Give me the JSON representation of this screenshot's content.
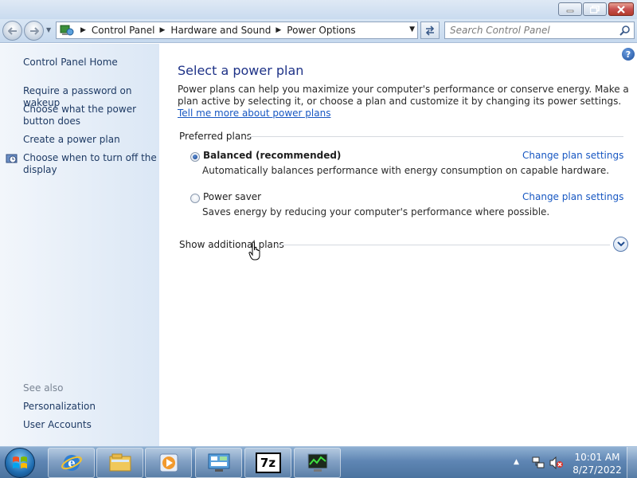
{
  "window": {
    "minimize_icon": "minimize-icon",
    "maximize_icon": "maximize-icon",
    "close_icon": "close-icon"
  },
  "address": {
    "breadcrumbs": [
      "Control Panel",
      "Hardware and Sound",
      "Power Options"
    ],
    "search_placeholder": "Search Control Panel"
  },
  "sidebar": {
    "home": "Control Panel Home",
    "items": [
      "Require a password on wakeup",
      "Choose what the power button does",
      "Create a power plan",
      "Choose when to turn off the display"
    ],
    "see_also_label": "See also",
    "see_also": [
      "Personalization",
      "User Accounts"
    ]
  },
  "main": {
    "title": "Select a power plan",
    "intro_text": "Power plans can help you maximize your computer's performance or conserve energy. Make a plan active by selecting it, or choose a plan and customize it by changing its power settings. ",
    "intro_link": "Tell me more about power plans",
    "preferred_label": "Preferred plans",
    "plans": [
      {
        "name": "Balanced (recommended)",
        "description": "Automatically balances performance with energy consumption on capable hardware.",
        "link": "Change plan settings",
        "selected": true
      },
      {
        "name": "Power saver",
        "description": "Saves energy by reducing your computer's performance where possible.",
        "link": "Change plan settings",
        "selected": false
      }
    ],
    "show_additional": "Show additional plans"
  },
  "taskbar": {
    "time": "10:01 AM",
    "date": "8/27/2022",
    "apps": [
      "internet-explorer-icon",
      "file-explorer-icon",
      "media-player-icon",
      "control-panel-icon",
      "7zip-icon",
      "task-manager-icon"
    ],
    "sevenzip_label": "7z"
  },
  "colors": {
    "link": "#1757c2",
    "title": "#1e3287",
    "sidebar_link": "#1e3a64"
  }
}
